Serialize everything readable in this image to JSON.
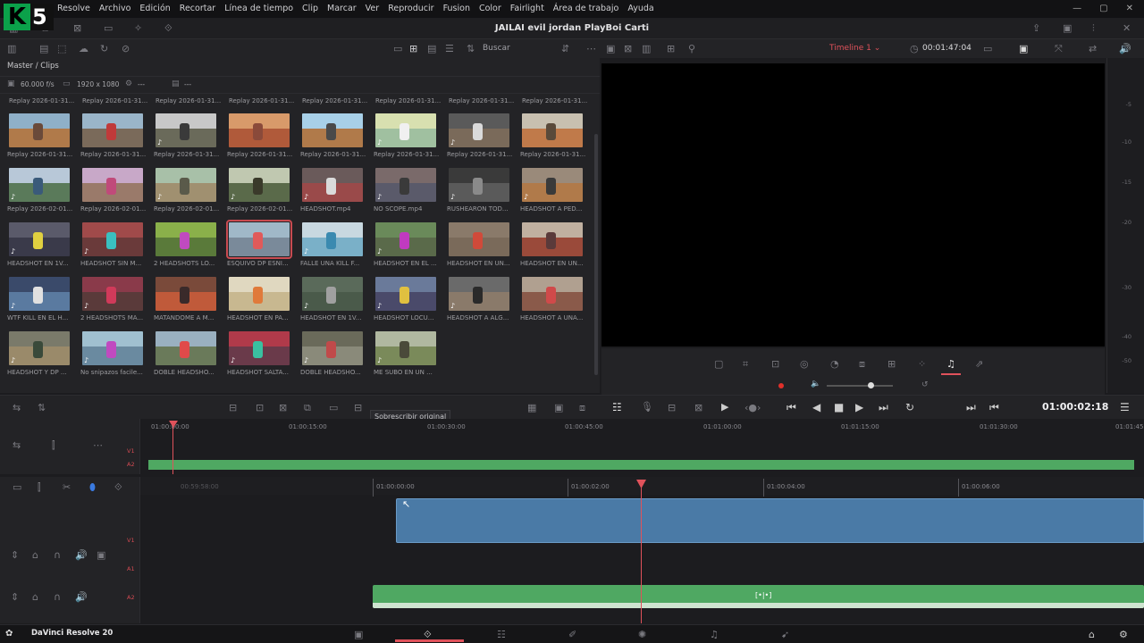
{
  "overlay_logo": {
    "letter": "K",
    "number": "5"
  },
  "menu": [
    "Resolve",
    "Archivo",
    "Edición",
    "Recortar",
    "Línea de tiempo",
    "Clip",
    "Marcar",
    "Ver",
    "Reproducir",
    "Fusion",
    "Color",
    "Fairlight",
    "Área de trabajo",
    "Ayuda"
  ],
  "project_title": "JAILAI evil jordan PlayBoi Carti",
  "toolbar": {
    "search_label": "Buscar",
    "timeline_name": "Timeline 1",
    "source_timecode": "00:01:47:04"
  },
  "media_pool": {
    "breadcrumb": "Master / Clips",
    "frame_rate": "60.000 f/s",
    "resolution": "1920 x 1080",
    "info_dash1": "---",
    "info_dash2": "---",
    "top_row_labels": [
      "Replay 2026-01-31...",
      "Replay 2026-01-31...",
      "Replay 2026-01-31...",
      "Replay 2026-01-31...",
      "Replay 2026-01-31...",
      "Replay 2026-01-31...",
      "Replay 2026-01-31...",
      "Replay 2026-01-31..."
    ],
    "clips": [
      {
        "label": "Replay 2026-01-31...",
        "sky": "#8fb0c8",
        "ground": "#b07a4a",
        "fig": "#6a4a3a",
        "audio": false
      },
      {
        "label": "Replay 2026-01-31...",
        "sky": "#9ab5c9",
        "ground": "#7a6a5a",
        "fig": "#c03a3a",
        "audio": false
      },
      {
        "label": "Replay 2026-01-31...",
        "sky": "#c8c8c8",
        "ground": "#6a6a5a",
        "fig": "#3a3a3a",
        "audio": true
      },
      {
        "label": "Replay 2026-01-31...",
        "sky": "#d89a6a",
        "ground": "#b05a3a",
        "fig": "#8a4a3a",
        "audio": false
      },
      {
        "label": "Replay 2026-01-31...",
        "sky": "#a8d0e8",
        "ground": "#b07a4a",
        "fig": "#4a4a4a",
        "audio": false
      },
      {
        "label": "Replay 2026-01-31...",
        "sky": "#d8e0b0",
        "ground": "#a0c0a0",
        "fig": "#f0f0f0",
        "audio": true
      },
      {
        "label": "Replay 2026-01-31...",
        "sky": "#5a5a5a",
        "ground": "#7a6a5a",
        "fig": "#dadada",
        "audio": true
      },
      {
        "label": "Replay 2026-01-31...",
        "sky": "#c8c0b0",
        "ground": "#c07a4a",
        "fig": "#5a4a3a",
        "audio": false
      },
      {
        "label": "Replay 2026-02-01...",
        "sky": "#b8c8d8",
        "ground": "#5a7a5a",
        "fig": "#3a5a7a",
        "audio": true
      },
      {
        "label": "Replay 2026-02-01...",
        "sky": "#c8a8c8",
        "ground": "#9a7a6a",
        "fig": "#c04a7a",
        "audio": false
      },
      {
        "label": "Replay 2026-02-01...",
        "sky": "#a8c0a8",
        "ground": "#a09070",
        "fig": "#5a5a4a",
        "audio": true
      },
      {
        "label": "Replay 2026-02-01...",
        "sky": "#c0c8b0",
        "ground": "#5a6a4a",
        "fig": "#3a3a2a",
        "audio": true
      },
      {
        "label": "HEADSHOT.mp4",
        "sky": "#6a5a5a",
        "ground": "#9a4a4a",
        "fig": "#dadada",
        "audio": true
      },
      {
        "label": "NO SCOPE.mp4",
        "sky": "#7a6a6a",
        "ground": "#5a5a6a",
        "fig": "#3a3a3a",
        "audio": true
      },
      {
        "label": "RUSHEARON TOD...",
        "sky": "#3a3a3a",
        "ground": "#5a5a5a",
        "fig": "#8a8a8a",
        "audio": true
      },
      {
        "label": "HEADSHOT A PED...",
        "sky": "#9a8a7a",
        "ground": "#b07a4a",
        "fig": "#3a3a3a",
        "audio": true
      },
      {
        "label": "HEADSHOT EN 1V...",
        "sky": "#5a5a6a",
        "ground": "#3a3a4a",
        "fig": "#e0d040",
        "audio": true
      },
      {
        "label": "HEADSHOT SIN M...",
        "sky": "#a04a4a",
        "ground": "#6a3a3a",
        "fig": "#3ac0c0",
        "audio": true
      },
      {
        "label": "2 HEADSHOTS LO...",
        "sky": "#8ab04a",
        "ground": "#5a7a3a",
        "fig": "#c04ac0",
        "audio": false
      },
      {
        "label": "ESQUIVO DP ESNI...",
        "sky": "#a0b8c8",
        "ground": "#7a8a9a",
        "fig": "#e05a5a",
        "audio": false,
        "selected": true
      },
      {
        "label": "FALLE UNA KILL F...",
        "sky": "#c8d8e0",
        "ground": "#7ab0c8",
        "fig": "#3a8ab0",
        "audio": true
      },
      {
        "label": "HEADSHOT EN EL ...",
        "sky": "#6a8a5a",
        "ground": "#5a6a4a",
        "fig": "#c03ac0",
        "audio": true
      },
      {
        "label": "HEADSHOT EN UN...",
        "sky": "#8a7a6a",
        "ground": "#7a6a5a",
        "fig": "#d04a3a",
        "audio": false
      },
      {
        "label": "HEADSHOT EN UN...",
        "sky": "#c0b0a0",
        "ground": "#9a4a3a",
        "fig": "#5a3a3a",
        "audio": false
      },
      {
        "label": "WTF KILL EN EL H...",
        "sky": "#3a4a6a",
        "ground": "#5a7aa0",
        "fig": "#e0e0e0",
        "audio": true
      },
      {
        "label": "2 HEADSHOTS MA...",
        "sky": "#8a3a4a",
        "ground": "#5a3a3a",
        "fig": "#d03a5a",
        "audio": true
      },
      {
        "label": "MATANDOME A M...",
        "sky": "#7a4a3a",
        "ground": "#c05a3a",
        "fig": "#3a2a2a",
        "audio": false
      },
      {
        "label": "HEADSHOT EN PA...",
        "sky": "#e0d8c0",
        "ground": "#c8b890",
        "fig": "#e07a3a",
        "audio": false
      },
      {
        "label": "HEADSHOT EN 1V...",
        "sky": "#5a6a5a",
        "ground": "#4a5a4a",
        "fig": "#a0a0a0",
        "audio": true
      },
      {
        "label": "HEADSHOT LOCU...",
        "sky": "#6a7a9a",
        "ground": "#4a4a6a",
        "fig": "#e0c040",
        "audio": true
      },
      {
        "label": "HEADSHOT A ALG...",
        "sky": "#6a6a6a",
        "ground": "#8a7a6a",
        "fig": "#2a2a2a",
        "audio": true
      },
      {
        "label": "HEADSHOT A UNA...",
        "sky": "#b0a090",
        "ground": "#8a5a4a",
        "fig": "#d04a4a",
        "audio": false
      },
      {
        "label": "HEADSHOT Y DP ...",
        "sky": "#7a7a6a",
        "ground": "#9a8a6a",
        "fig": "#3a4a3a",
        "audio": true
      },
      {
        "label": "No snipazos facile...",
        "sky": "#a0c0d0",
        "ground": "#6a8aa0",
        "fig": "#c04ac0",
        "audio": true
      },
      {
        "label": "DOBLE HEADSHO...",
        "sky": "#9ab0c0",
        "ground": "#6a7a5a",
        "fig": "#e04a4a",
        "audio": false
      },
      {
        "label": "HEADSHOT SALTA...",
        "sky": "#b03a4a",
        "ground": "#6a3a4a",
        "fig": "#3ac0a0",
        "audio": true
      },
      {
        "label": "DOBLE HEADSHO...",
        "sky": "#6a6a5a",
        "ground": "#8a8a7a",
        "fig": "#c04a4a",
        "audio": true
      },
      {
        "label": "ME SUBO EN UN ...",
        "sky": "#b0b8a0",
        "ground": "#7a8a5a",
        "fig": "#4a4a3a",
        "audio": true
      }
    ]
  },
  "meter_scale": [
    "-5",
    "-10",
    "-15",
    "-20",
    "-30",
    "-40",
    "-50"
  ],
  "tooltip": "Sobrescribir original",
  "transport": {
    "timecode": "01:00:02:18"
  },
  "upper_timeline": {
    "ruler": [
      "01:00:00:00",
      "01:00:15:00",
      "01:00:30:00",
      "01:00:45:00",
      "01:01:00:00",
      "01:01:15:00",
      "01:01:30:00",
      "01:01:45"
    ],
    "tracks": [
      "V1",
      "A2"
    ]
  },
  "lower_timeline": {
    "ruler": [
      "00:59:58:00",
      "01:00:00:00",
      "01:00:02:00",
      "01:00:04:00",
      "01:00:06:00"
    ],
    "tracks": [
      "V1",
      "A1",
      "A2"
    ],
    "audio_marker": "[•|•]"
  },
  "app_name": "DaVinci Resolve 20"
}
